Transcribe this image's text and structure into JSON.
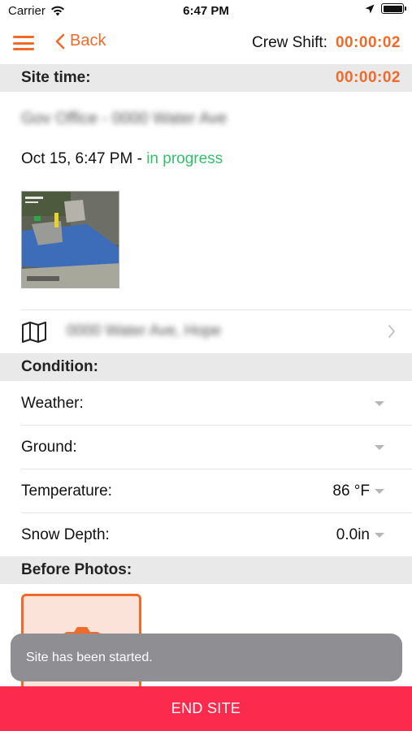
{
  "status_bar": {
    "carrier": "Carrier",
    "time": "6:47 PM"
  },
  "nav": {
    "back_label": "Back",
    "crew_shift_label": "Crew Shift:",
    "crew_shift_time": "00:00:02"
  },
  "site_time": {
    "label": "Site time:",
    "value": "00:00:02"
  },
  "site": {
    "name": "Gov Office - 0000 Water Ave",
    "date": "Oct 15, 6:47 PM",
    "separator": " - ",
    "status": "in progress",
    "address": "0000 Water Ave, Hope"
  },
  "condition": {
    "header": "Condition:",
    "fields": [
      {
        "label": "Weather:",
        "value": ""
      },
      {
        "label": "Ground:",
        "value": ""
      },
      {
        "label": "Temperature:",
        "value": "86 °F"
      },
      {
        "label": "Snow Depth:",
        "value": "0.0in"
      }
    ]
  },
  "before_photos": {
    "header": "Before Photos:"
  },
  "toast": {
    "message": "Site has been started."
  },
  "end_site_label": "END SITE",
  "colors": {
    "accent": "#f06a2a",
    "status_green": "#34c06a",
    "end_button": "#fc2b4e",
    "section_bg": "#e9e9ea",
    "toast_bg": "#8e8e93"
  },
  "icons": [
    "wifi-icon",
    "location-arrow-icon",
    "battery-icon",
    "hamburger-menu-icon",
    "chevron-left-icon",
    "map-icon",
    "chevron-right-icon",
    "dropdown-caret-icon",
    "camera-icon"
  ]
}
